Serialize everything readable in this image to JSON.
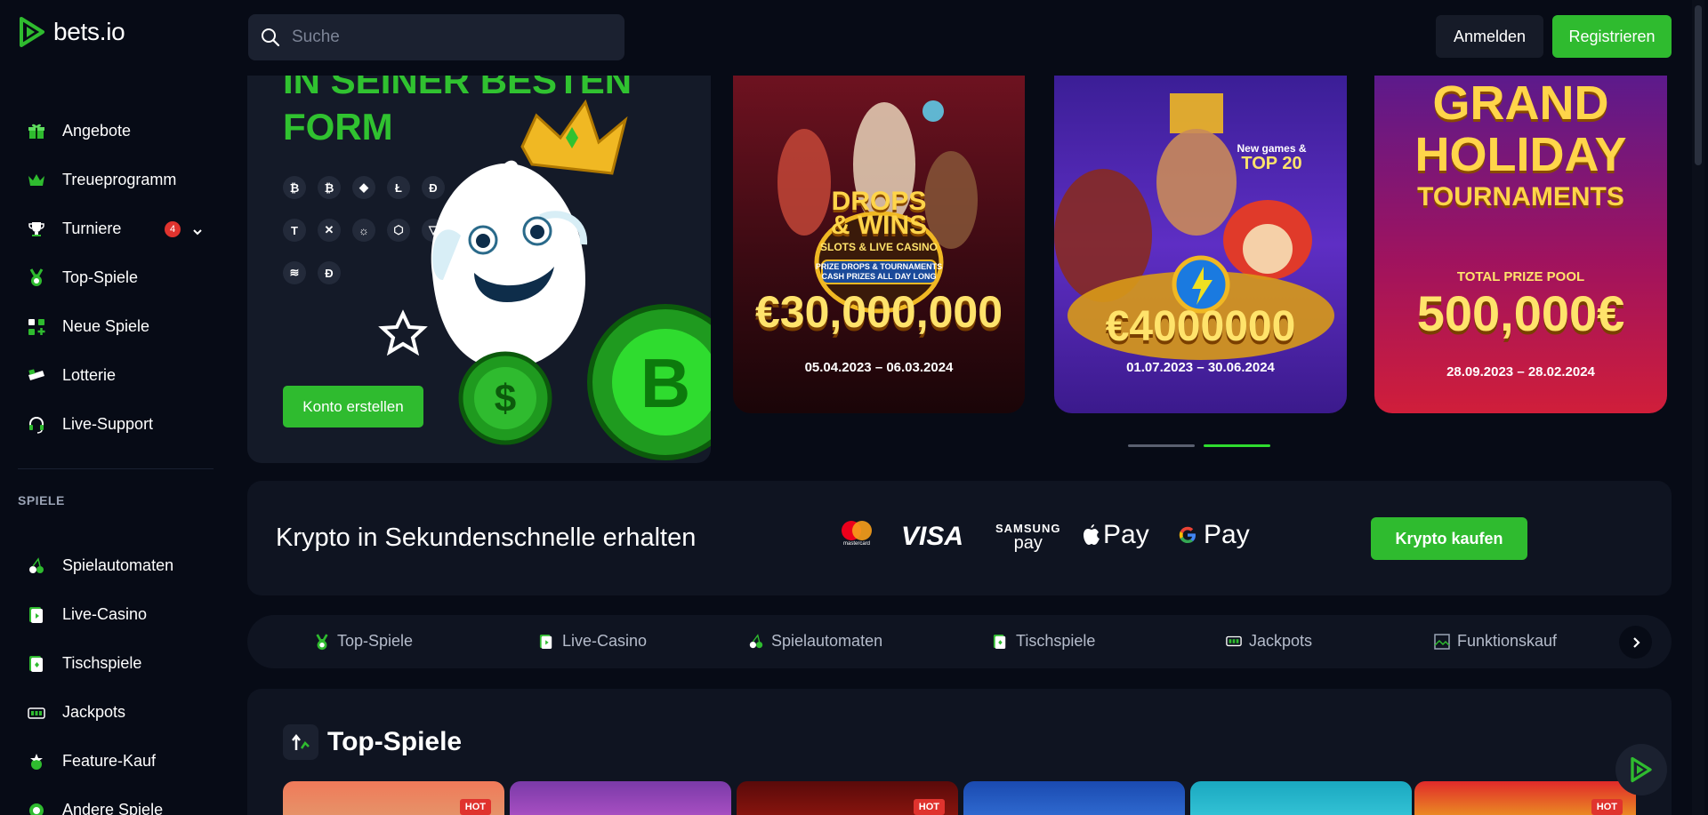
{
  "brand": {
    "name": "bets.io",
    "accent": "#2fbb2f"
  },
  "search": {
    "placeholder": "Suche"
  },
  "header": {
    "login_label": "Anmelden",
    "register_label": "Registrieren"
  },
  "sidebar": {
    "items": [
      {
        "label": "Angebote",
        "icon": "gift-icon"
      },
      {
        "label": "Treueprogramm",
        "icon": "crown-icon"
      },
      {
        "label": "Turniere",
        "icon": "trophy-icon",
        "badge": "4"
      },
      {
        "label": "Top-Spiele",
        "icon": "medal-icon"
      },
      {
        "label": "Neue Spiele",
        "icon": "grid-plus-icon"
      },
      {
        "label": "Lotterie",
        "icon": "ticket-icon"
      },
      {
        "label": "Live-Support",
        "icon": "headset-icon"
      }
    ],
    "section_label": "SPIELE",
    "game_items": [
      {
        "label": "Spielautomaten",
        "icon": "cherries-icon"
      },
      {
        "label": "Live-Casino",
        "icon": "live-card-icon"
      },
      {
        "label": "Tischspiele",
        "icon": "cards-icon"
      },
      {
        "label": "Jackpots",
        "icon": "jackpot-icon"
      },
      {
        "label": "Feature-Kauf",
        "icon": "feature-icon"
      },
      {
        "label": "Andere Spiele",
        "icon": "other-games-icon"
      }
    ]
  },
  "hero": {
    "title_line1": "IN SEINER BESTEN",
    "title_line2": "FORM",
    "cta_label": "Konto erstellen",
    "crypto_symbols": [
      "₿",
      "₿",
      "◆",
      "Ł",
      "Đ",
      "T",
      "✕",
      "☼",
      "⬡",
      "▽",
      "≋",
      "Ð"
    ]
  },
  "promos": [
    {
      "title1": "DROPS",
      "title2": "& WINS",
      "sub": "SLOTS & LIVE CASINO",
      "sub2": "PRIZE DROPS & TOURNAMENTS",
      "sub3": "CASH PRIZES ALL DAY LONG",
      "amount": "€30,000,000",
      "dates": "05.04.2023 – 06.03.2024"
    },
    {
      "tag1": "New games &",
      "tag2": "TOP 20",
      "amount": "€4000000",
      "dates": "01.07.2023 – 30.06.2024"
    },
    {
      "title1": "GRAND",
      "title2": "HOLIDAY",
      "title3": "TOURNAMENTS",
      "pool_label": "TOTAL PRIZE POOL",
      "amount": "500,000€",
      "dates": "28.09.2023 – 28.02.2024"
    }
  ],
  "crypto_bar": {
    "text": "Krypto in Sekundenschnelle erhalten",
    "payments": [
      "mastercard",
      "VISA",
      "SAMSUNG",
      "pay",
      "Pay",
      "Pay"
    ],
    "buy_label": "Krypto kaufen"
  },
  "categories": [
    {
      "label": "Top-Spiele",
      "icon": "medal-icon"
    },
    {
      "label": "Live-Casino",
      "icon": "live-card-icon"
    },
    {
      "label": "Spielautomaten",
      "icon": "cherries-icon"
    },
    {
      "label": "Tischspiele",
      "icon": "cards-icon"
    },
    {
      "label": "Jackpots",
      "icon": "jackpot-icon"
    },
    {
      "label": "Funktionskauf",
      "icon": "broken-image-icon"
    }
  ],
  "games_section": {
    "title": "Top-Spiele",
    "hot_label": "HOT"
  }
}
